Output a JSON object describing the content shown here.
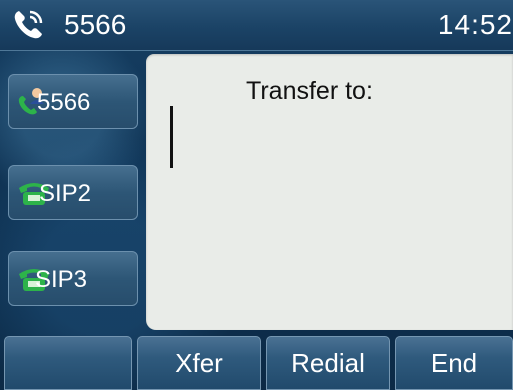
{
  "status_bar": {
    "account": "5566",
    "time": "14:52",
    "icon": "handset-call-icon"
  },
  "line_keys": [
    {
      "label": "5566",
      "icon": "contact-call-icon"
    },
    {
      "label": "SIP2",
      "icon": "green-phone-icon"
    },
    {
      "label": "SIP3",
      "icon": "green-phone-icon"
    }
  ],
  "panel": {
    "title": "Transfer to:",
    "input_value": ""
  },
  "softkeys": [
    {
      "label": ""
    },
    {
      "label": "Xfer"
    },
    {
      "label": "Redial"
    },
    {
      "label": "End"
    }
  ],
  "colors": {
    "background": "#0f3354",
    "panel": "#e9ece8",
    "phone_green": "#2db34a"
  }
}
